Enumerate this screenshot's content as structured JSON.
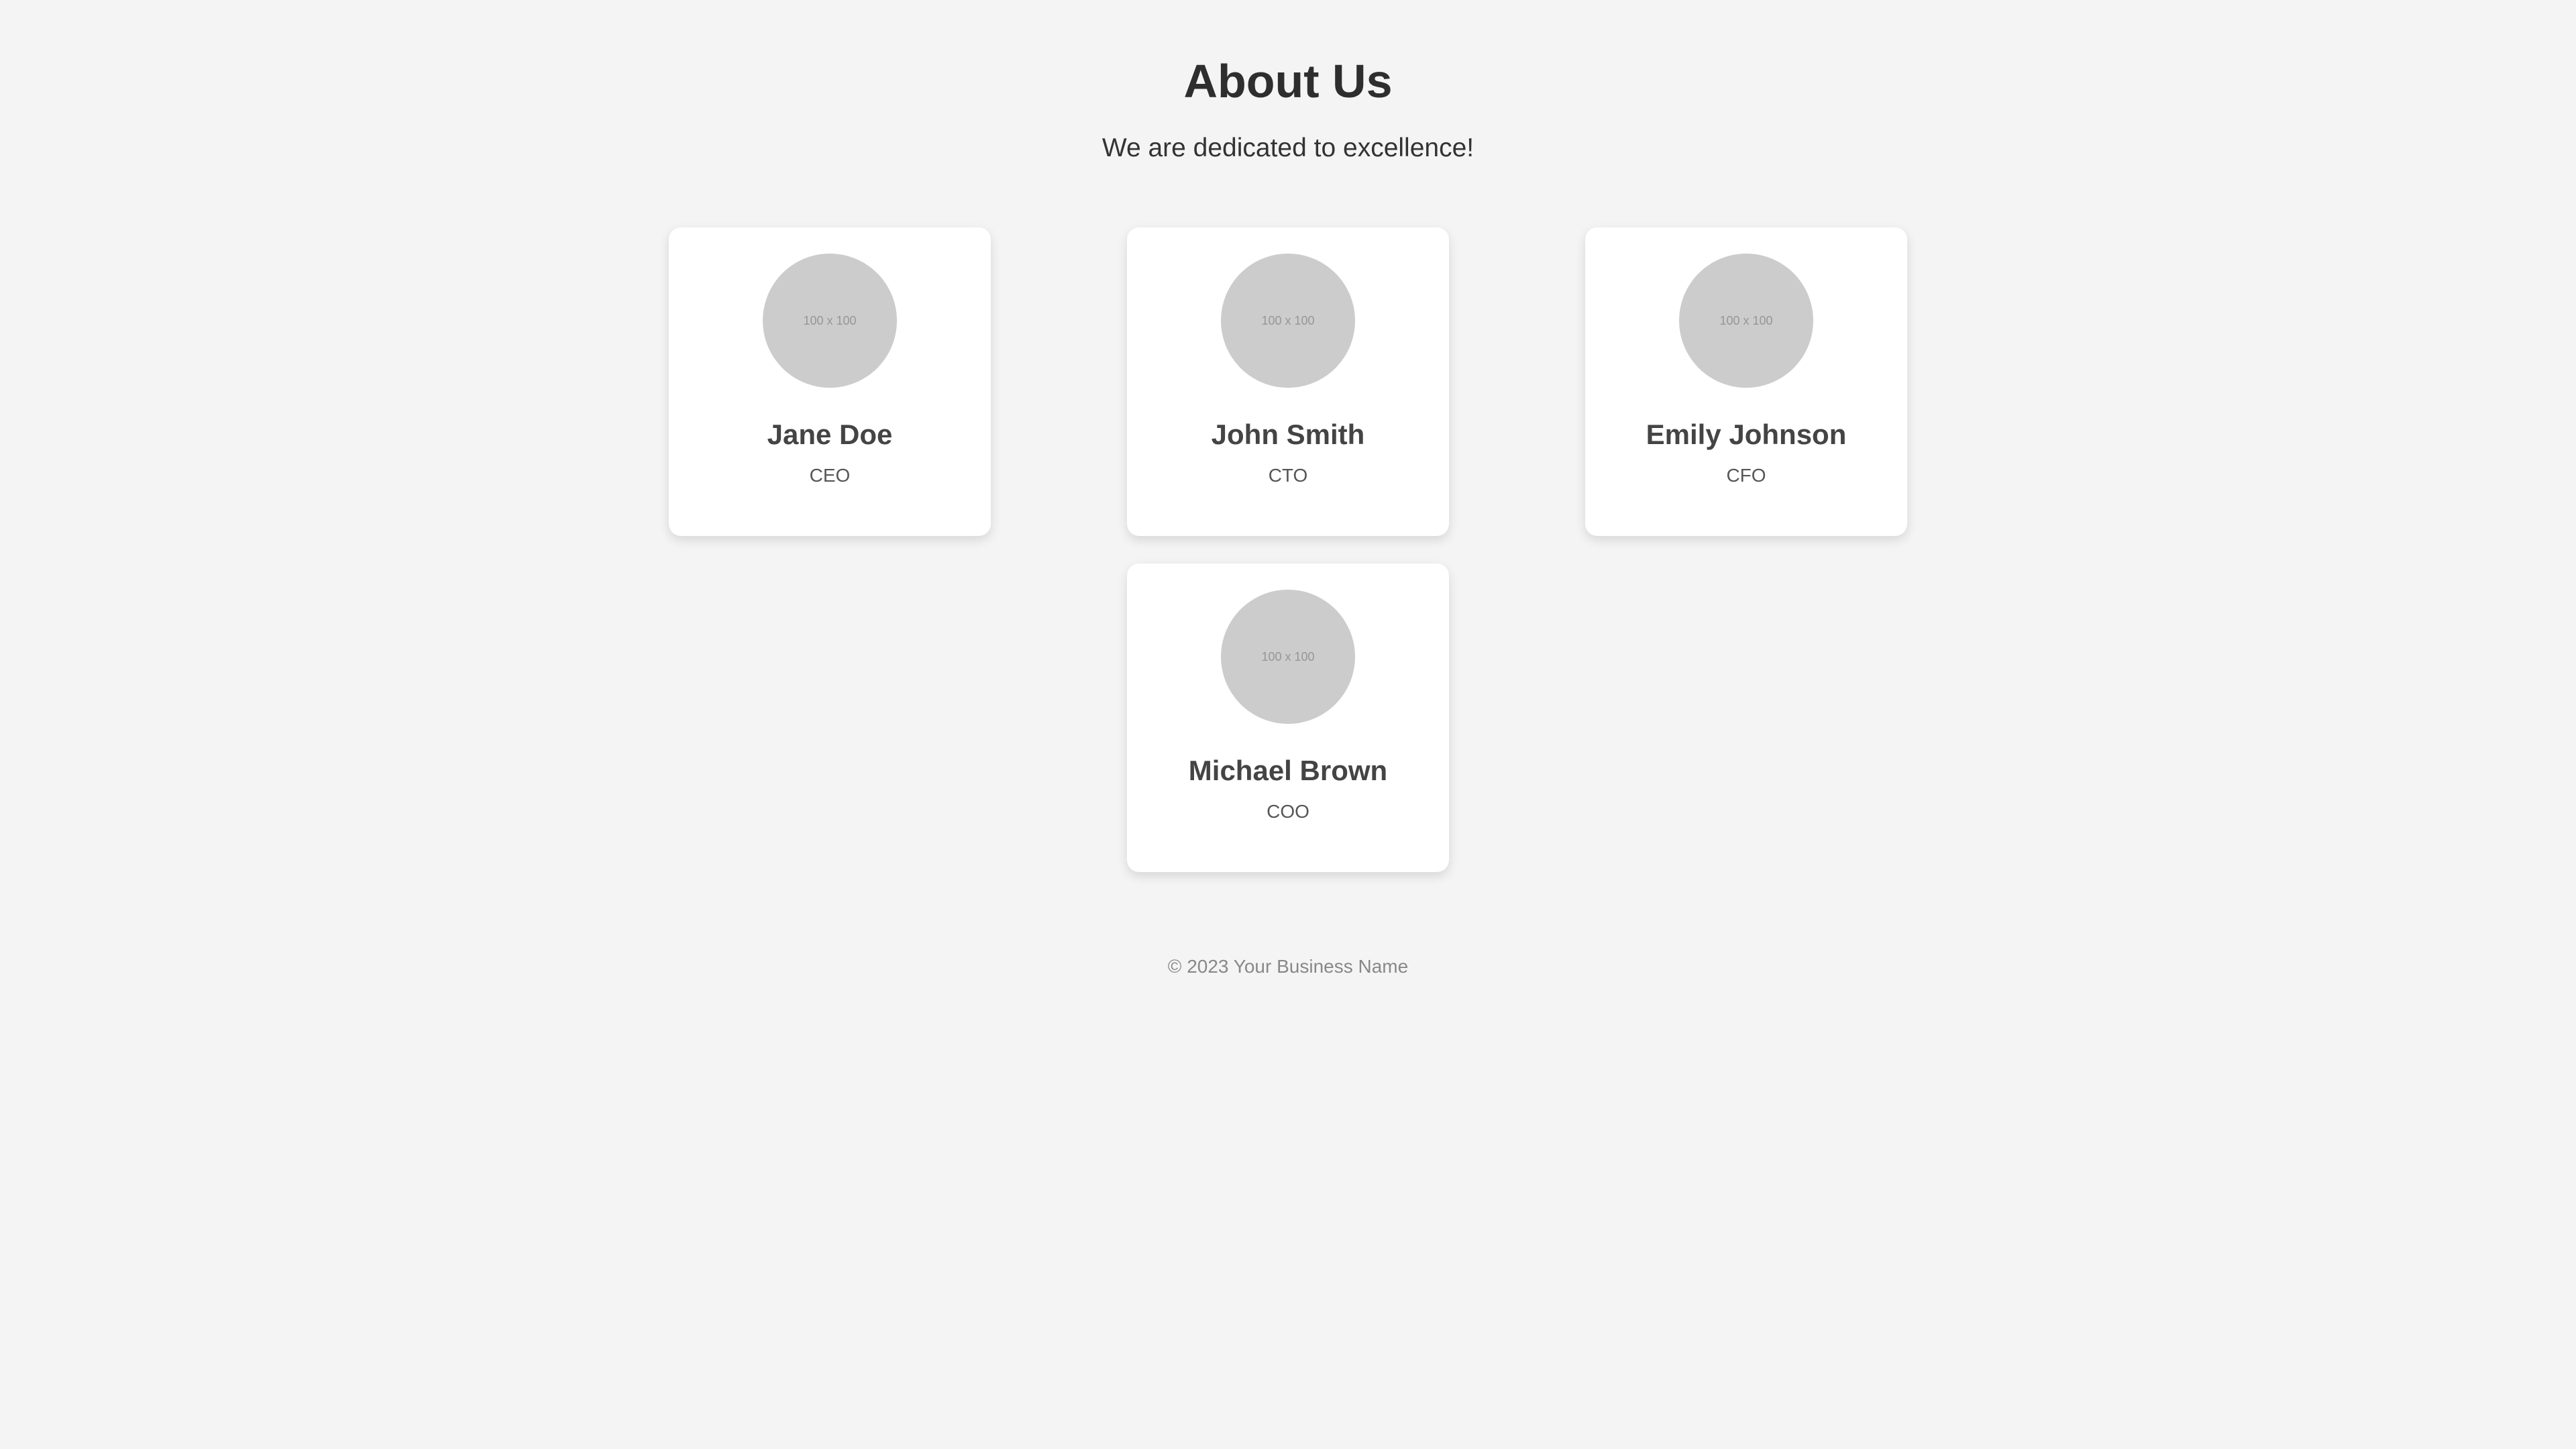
{
  "header": {
    "title": "About Us",
    "tagline": "We are dedicated to excellence!"
  },
  "team": [
    {
      "name": "Jane Doe",
      "role": "CEO",
      "avatar_placeholder": "100 x 100"
    },
    {
      "name": "John Smith",
      "role": "CTO",
      "avatar_placeholder": "100 x 100"
    },
    {
      "name": "Emily Johnson",
      "role": "CFO",
      "avatar_placeholder": "100 x 100"
    },
    {
      "name": "Michael Brown",
      "role": "COO",
      "avatar_placeholder": "100 x 100"
    }
  ],
  "footer": {
    "copyright": "© 2023 Your Business Name"
  },
  "colors": {
    "background": "#f4f4f4",
    "card": "#ffffff",
    "avatar": "#cccccc",
    "heading": "#2e2e2e",
    "footer_text": "#888888"
  }
}
